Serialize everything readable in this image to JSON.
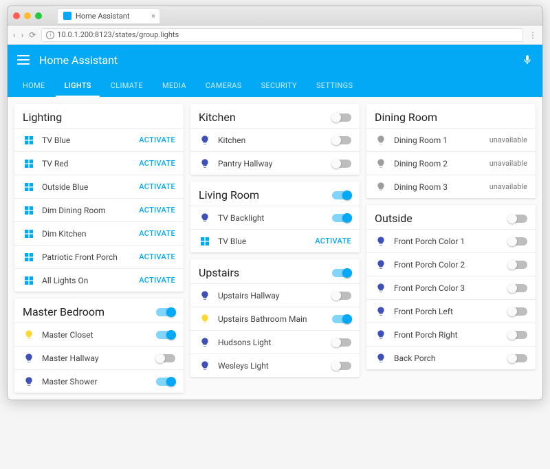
{
  "browser": {
    "tab_title": "Home Assistant",
    "url": "10.0.1.200:8123/states/group.lights"
  },
  "header": {
    "title": "Home Assistant"
  },
  "tabs": [
    "HOME",
    "LIGHTS",
    "CLIMATE",
    "MEDIA",
    "CAMERAS",
    "SECURITY",
    "SETTINGS"
  ],
  "active_tab": "LIGHTS",
  "activate_label": "ACTIVATE",
  "unavailable_label": "unavailable",
  "cards": {
    "lighting": {
      "title": "Lighting",
      "items": [
        {
          "label": "TV Blue"
        },
        {
          "label": "TV Red"
        },
        {
          "label": "Outside Blue"
        },
        {
          "label": "Dim Dining Room"
        },
        {
          "label": "Dim Kitchen"
        },
        {
          "label": "Patriotic Front Porch"
        },
        {
          "label": "All Lights On"
        }
      ]
    },
    "master_bedroom": {
      "title": "Master Bedroom",
      "items": [
        {
          "label": "Master Closet"
        },
        {
          "label": "Master Hallway"
        },
        {
          "label": "Master Shower"
        }
      ]
    },
    "kitchen": {
      "title": "Kitchen",
      "items": [
        {
          "label": "Kitchen"
        },
        {
          "label": "Pantry Hallway"
        }
      ]
    },
    "living_room": {
      "title": "Living Room",
      "items": [
        {
          "label": "TV Backlight"
        },
        {
          "label": "TV Blue"
        }
      ]
    },
    "upstairs": {
      "title": "Upstairs",
      "items": [
        {
          "label": "Upstairs Hallway"
        },
        {
          "label": "Upstairs Bathroom Main"
        },
        {
          "label": "Hudsons Light"
        },
        {
          "label": "Wesleys Light"
        }
      ]
    },
    "dining_room": {
      "title": "Dining Room",
      "items": [
        {
          "label": "Dining Room 1"
        },
        {
          "label": "Dining Room 2"
        },
        {
          "label": "Dining Room 3"
        }
      ]
    },
    "outside": {
      "title": "Outside",
      "items": [
        {
          "label": "Front Porch Color 1"
        },
        {
          "label": "Front Porch Color 2"
        },
        {
          "label": "Front Porch Color 3"
        },
        {
          "label": "Front Porch Left"
        },
        {
          "label": "Front Porch Right"
        },
        {
          "label": "Back Porch"
        }
      ]
    }
  }
}
